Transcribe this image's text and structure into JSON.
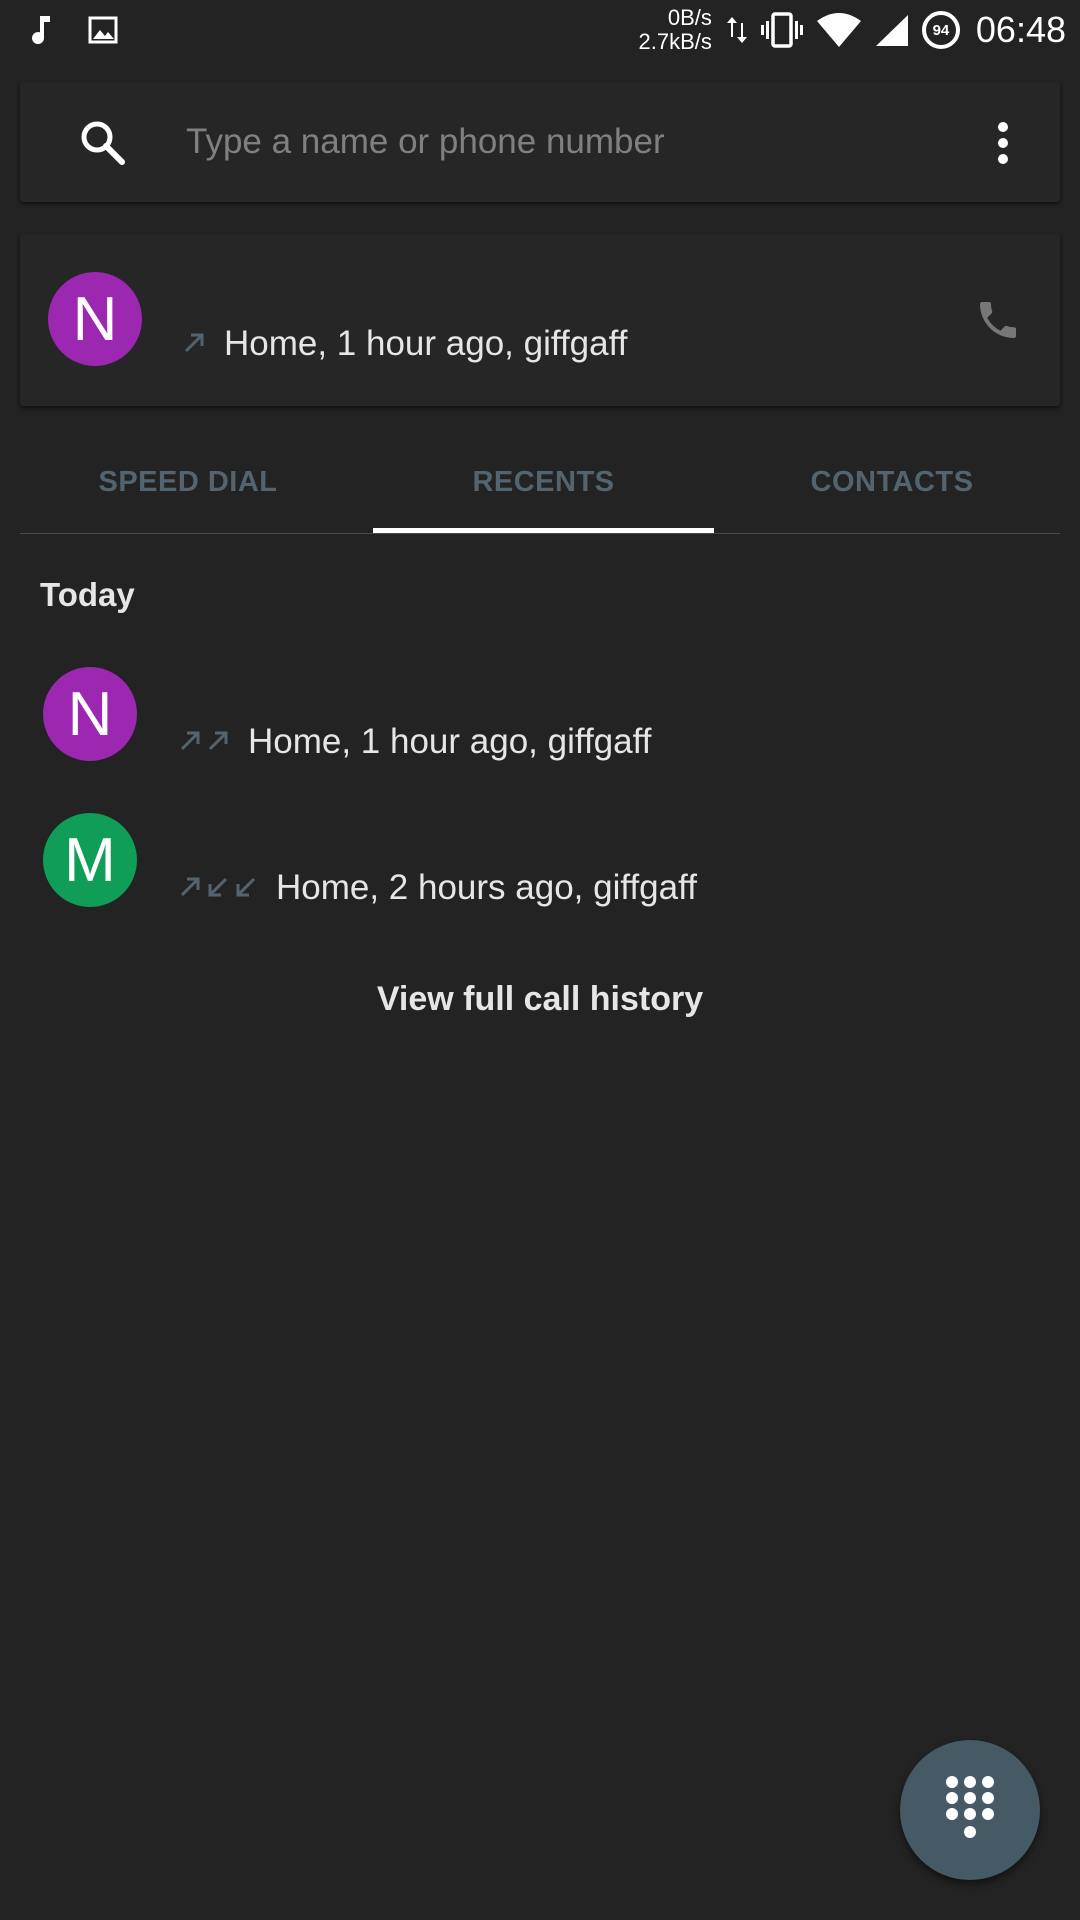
{
  "status_bar": {
    "net_up": "0B/s",
    "net_down": "2.7kB/s",
    "battery": "94",
    "time": "06:48",
    "left_icons": [
      "music-note-icon",
      "image-icon"
    ],
    "right_icons": [
      "data-transfer-icon",
      "vibrate-icon",
      "wifi-icon",
      "cell-signal-icon"
    ]
  },
  "search": {
    "placeholder": "Type a name or phone number",
    "value": ""
  },
  "suggestion": {
    "avatar_letter": "N",
    "avatar_color": "#9c27b0",
    "detail": "Home, 1 hour ago, giffgaff",
    "call_icons": [
      "outgoing-call-icon"
    ]
  },
  "tabs": [
    {
      "label": "SPEED DIAL",
      "selected": false
    },
    {
      "label": "RECENTS",
      "selected": true
    },
    {
      "label": "CONTACTS",
      "selected": false
    }
  ],
  "recents": {
    "section": "Today",
    "calls": [
      {
        "avatar_letter": "N",
        "avatar_color": "#9c27b0",
        "detail": "Home, 1 hour ago, giffgaff",
        "call_icons": [
          "outgoing-call-icon",
          "outgoing-call-icon"
        ]
      },
      {
        "avatar_letter": "M",
        "avatar_color": "#0f9d58",
        "detail": "Home, 2 hours ago, giffgaff",
        "call_icons": [
          "outgoing-call-icon",
          "incoming-call-icon",
          "incoming-call-icon"
        ]
      }
    ],
    "view_history_label": "View full call history"
  },
  "colors": {
    "background": "#232323",
    "card": "#262626",
    "tab_text": "#54646e",
    "arrow": "#54646e",
    "fab": "#455a64"
  },
  "fab_icon": "dialpad-icon"
}
